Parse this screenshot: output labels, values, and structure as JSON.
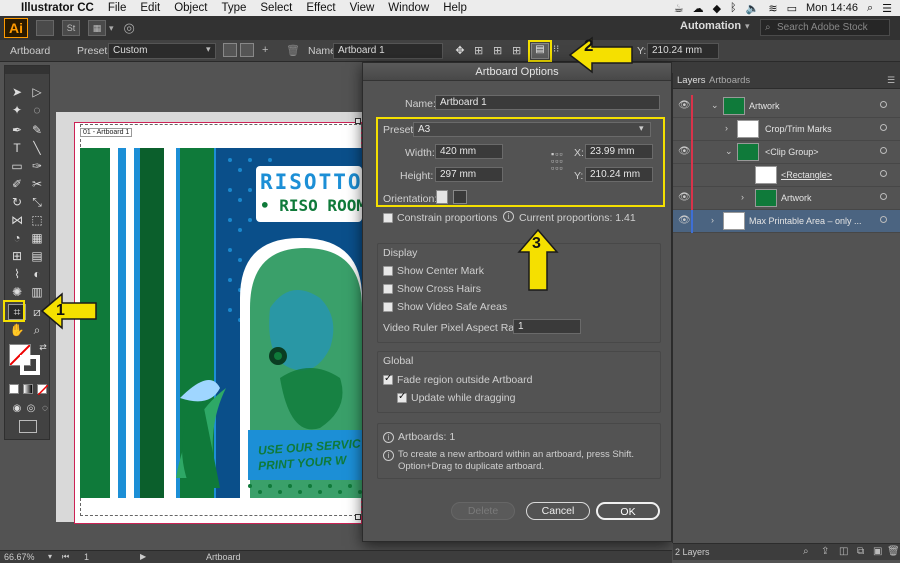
{
  "menubar": {
    "app_name": "Illustrator CC",
    "items": [
      "File",
      "Edit",
      "Object",
      "Type",
      "Select",
      "Effect",
      "View",
      "Window",
      "Help"
    ],
    "clock": "Mon 14:46"
  },
  "appbar": {
    "logo": "Ai",
    "st_label": "St",
    "workspace": "Automation",
    "stock_placeholder": "Search Adobe Stock"
  },
  "control": {
    "artboard_label": "Artboard",
    "presets_label": "Presets:",
    "presets_value": "Custom",
    "name_label": "Name:",
    "name_value": "Artboard 1",
    "y_label": "Y:",
    "y_value": "210.24 mm"
  },
  "canvas": {
    "artboard_tag": "01 - Artboard 1",
    "poster_line1": "RISOTTO",
    "poster_line2": "• RISO ROOM",
    "poster_line3": "USE OUR SERVIC",
    "poster_line4": "PRINT YOUR W"
  },
  "dialog": {
    "title": "Artboard Options",
    "name_label": "Name:",
    "name_value": "Artboard 1",
    "preset_label": "Preset:",
    "preset_value": "A3",
    "width_label": "Width:",
    "width_value": "420 mm",
    "height_label": "Height:",
    "height_value": "297 mm",
    "x_label": "X:",
    "x_value": "23.99 mm",
    "y_label": "Y:",
    "y_value": "210.24 mm",
    "orientation_label": "Orientation:",
    "constrain_label": "Constrain proportions",
    "current_props": "Current proportions: 1.41",
    "display_heading": "Display",
    "center_mark": "Show Center Mark",
    "cross_hairs": "Show Cross Hairs",
    "video_safe": "Show Video Safe Areas",
    "video_ratio_label": "Video Ruler Pixel Aspect Ratio:",
    "video_ratio_value": "1",
    "global_heading": "Global",
    "fade_region": "Fade region outside Artboard",
    "update_drag": "Update while dragging",
    "artboards_count": "Artboards: 1",
    "hint": "To create a new artboard within an artboard, press Shift. Option+Drag to duplicate artboard.",
    "delete_label": "Delete",
    "cancel_label": "Cancel",
    "ok_label": "OK"
  },
  "layers": {
    "tab_layers": "Layers",
    "tab_artboards": "Artboards",
    "rows": [
      {
        "name": "Artwork"
      },
      {
        "name": "Crop/Trim Marks"
      },
      {
        "name": "<Clip Group>"
      },
      {
        "name": "<Rectangle>"
      },
      {
        "name": "Artwork"
      },
      {
        "name": "Max Printable Area – only ..."
      }
    ],
    "footer": "2 Layers"
  },
  "status": {
    "zoom": "66.67%",
    "page": "1",
    "tool": "Artboard"
  },
  "annotations": [
    "1",
    "2",
    "3"
  ],
  "colors": {
    "highlight": "#f5e000",
    "selection": "#d9334a",
    "poster_green": "#0f7a3a",
    "poster_blue": "#1c8fd6"
  }
}
